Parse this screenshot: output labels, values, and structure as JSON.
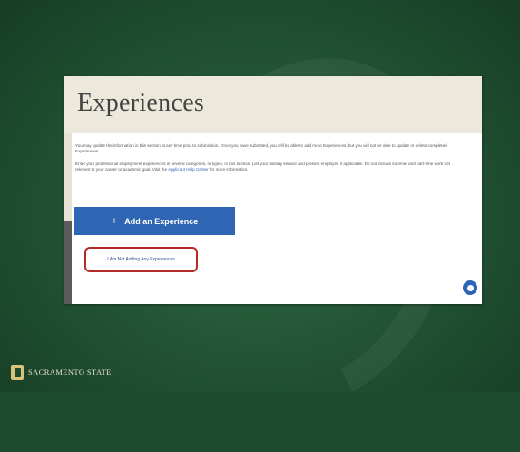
{
  "page": {
    "title": "Experiences",
    "intro_paragraph": "You may update the information in this section at any time prior to submission. Once you have submitted, you will be able to add more Experiences, but you will not be able to update or delete completed Experiences.",
    "instructions_paragraph": "Enter your professional employment experiences in several categories, or types, in this section. List your military service and present employer, if applicable. Do not include summer and part-time work not relevant to your career or academic goal. Visit the",
    "instructions_link": "Applicant Help Center",
    "instructions_suffix": " for more information.",
    "add_button_label": "Add an Experience",
    "add_button_icon": "plus-icon",
    "not_adding_label": "I Am Not Adding Any Experiences",
    "chat_icon": "chat-bubble-icon"
  },
  "branding": {
    "logo_text": "SACRAMENTO STATE",
    "logo_icon": "hornet-logo-icon"
  },
  "colors": {
    "slide_background": "#235535",
    "primary_button": "#2f66b3",
    "highlight_border": "#b42a2a",
    "link": "#2b64b5"
  }
}
